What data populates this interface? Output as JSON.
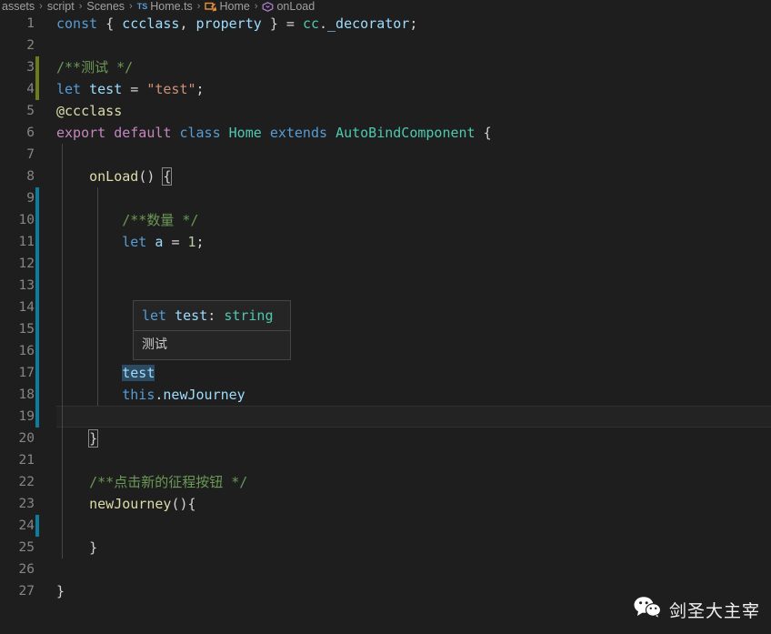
{
  "breadcrumb": {
    "items": [
      {
        "label": "assets",
        "icon": "none"
      },
      {
        "label": "script",
        "icon": "none"
      },
      {
        "label": "Scenes",
        "icon": "none"
      },
      {
        "label": "Home.ts",
        "icon": "typescript-file-icon"
      },
      {
        "label": "Home",
        "icon": "class-symbol-icon"
      },
      {
        "label": "onLoad",
        "icon": "method-symbol-icon"
      }
    ],
    "separator": "›"
  },
  "editor": {
    "language": "typescript",
    "current_line": 19,
    "lines": [
      {
        "num": 1,
        "gutter": "none",
        "indent_guides": [],
        "text": "const { ccclass, property } = cc._decorator;"
      },
      {
        "num": 2,
        "gutter": "none",
        "indent_guides": [],
        "text": ""
      },
      {
        "num": 3,
        "gutter": "modified",
        "indent_guides": [],
        "text": "/**测试 */"
      },
      {
        "num": 4,
        "gutter": "modified",
        "indent_guides": [],
        "text": "let test = \"test\";"
      },
      {
        "num": 5,
        "gutter": "none",
        "indent_guides": [],
        "text": "@ccclass"
      },
      {
        "num": 6,
        "gutter": "none",
        "indent_guides": [],
        "text": "export default class Home extends AutoBindComponent {"
      },
      {
        "num": 7,
        "gutter": "none",
        "indent_guides": [
          68
        ],
        "text": ""
      },
      {
        "num": 8,
        "gutter": "none",
        "indent_guides": [
          68
        ],
        "text": "    onLoad() {"
      },
      {
        "num": 9,
        "gutter": "added",
        "indent_guides": [
          68,
          107
        ],
        "text": ""
      },
      {
        "num": 10,
        "gutter": "added",
        "indent_guides": [
          68,
          107
        ],
        "text": "        /**数量 */"
      },
      {
        "num": 11,
        "gutter": "added",
        "indent_guides": [
          68,
          107
        ],
        "text": "        let a = 1;"
      },
      {
        "num": 12,
        "gutter": "added",
        "indent_guides": [
          68,
          107
        ],
        "text": ""
      },
      {
        "num": 13,
        "gutter": "added",
        "indent_guides": [
          68,
          107
        ],
        "text": ""
      },
      {
        "num": 14,
        "gutter": "added",
        "indent_guides": [
          68,
          107
        ],
        "text": ""
      },
      {
        "num": 15,
        "gutter": "added",
        "indent_guides": [
          68,
          107
        ],
        "text": ""
      },
      {
        "num": 16,
        "gutter": "added",
        "indent_guides": [
          68,
          107
        ],
        "text": ""
      },
      {
        "num": 17,
        "gutter": "added",
        "indent_guides": [
          68,
          107
        ],
        "text": "        test"
      },
      {
        "num": 18,
        "gutter": "added",
        "indent_guides": [
          68,
          107
        ],
        "text": "        this.newJourney"
      },
      {
        "num": 19,
        "gutter": "added",
        "indent_guides": [
          68
        ],
        "text": ""
      },
      {
        "num": 20,
        "gutter": "none",
        "indent_guides": [
          68
        ],
        "text": "    }"
      },
      {
        "num": 21,
        "gutter": "none",
        "indent_guides": [
          68
        ],
        "text": ""
      },
      {
        "num": 22,
        "gutter": "none",
        "indent_guides": [
          68
        ],
        "text": "    /**点击新的征程按钮 */"
      },
      {
        "num": 23,
        "gutter": "none",
        "indent_guides": [
          68
        ],
        "text": "    newJourney(){"
      },
      {
        "num": 24,
        "gutter": "added",
        "indent_guides": [
          68
        ],
        "text": ""
      },
      {
        "num": 25,
        "gutter": "none",
        "indent_guides": [
          68
        ],
        "text": "    }"
      },
      {
        "num": 26,
        "gutter": "none",
        "indent_guides": [],
        "text": ""
      },
      {
        "num": 27,
        "gutter": "none",
        "indent_guides": [],
        "text": "}"
      }
    ]
  },
  "hover": {
    "signature": "let test: string",
    "signature_tokens": [
      {
        "text": "let",
        "color": "#569cd6"
      },
      {
        "text": " ",
        "color": "#d4d4d4"
      },
      {
        "text": "test",
        "color": "#9cdcfe"
      },
      {
        "text": ":",
        "color": "#d4d4d4"
      },
      {
        "text": " ",
        "color": "#d4d4d4"
      },
      {
        "text": "string",
        "color": "#4ec9b0"
      }
    ],
    "documentation": "测试"
  },
  "watermark": {
    "text": "剑圣大主宰",
    "icon": "wechat-logo-icon"
  },
  "theme": {
    "background": "#1e1e1e",
    "foreground": "#d4d4d4",
    "line_number": "#868686",
    "current_line_bg": "#232323",
    "gutter_added": "#0c7d9d",
    "gutter_modified": "#6a7d1a",
    "selection_highlight": "#2c4a62",
    "hover_bg": "#252526",
    "hover_border": "#454545",
    "indent_guide": "#474747",
    "keyword": "#569cd6",
    "keyword_control": "#c586c0",
    "type": "#4ec9b0",
    "variable": "#9cdcfe",
    "function": "#dcdcaa",
    "string": "#ce9178",
    "number": "#b5cea8",
    "comment": "#6a9955"
  }
}
